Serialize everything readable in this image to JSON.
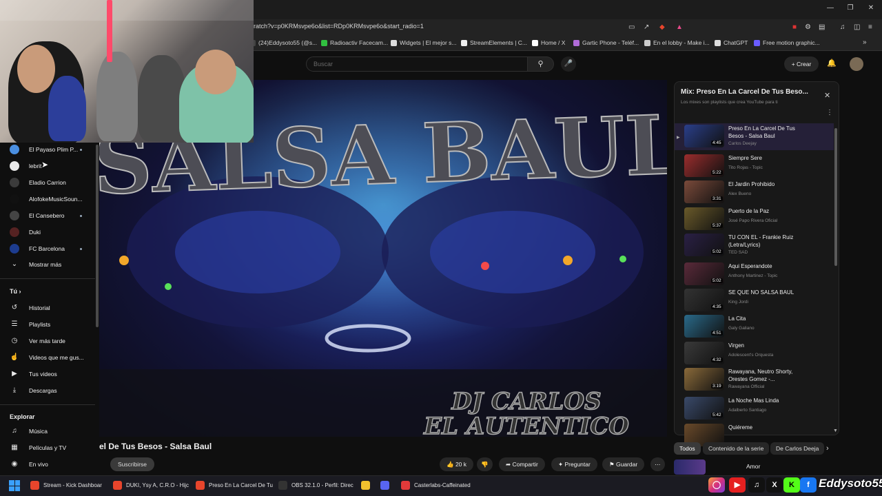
{
  "browser": {
    "url": "ratch?v=p0KRMsvpe6o&list=RDp0KRMsvpe6o&start_radio=1",
    "bookmarks": [
      {
        "label": "(24)Eddysoto55 (@s...",
        "color": "#444"
      },
      {
        "label": "Radioactiv Facecam...",
        "color": "#31c040"
      },
      {
        "label": "Widgets | El mejor s...",
        "color": "#ddd"
      },
      {
        "label": "StreamElements | C...",
        "color": "#eee"
      },
      {
        "label": "Home / X",
        "color": "#fff"
      },
      {
        "label": "Gartic Phone - Teléf...",
        "color": "#b06bd8"
      },
      {
        "label": "En el lobby - Make i...",
        "color": "#ccc"
      },
      {
        "label": "ChatGPT",
        "color": "#ddd"
      },
      {
        "label": "Free motion graphic...",
        "color": "#6a5cff"
      }
    ]
  },
  "header": {
    "search_placeholder": "Buscar",
    "create_label": "Crear"
  },
  "sidebar": {
    "subscriptions": [
      {
        "label": "El Payaso Plim P...",
        "color": "#4a8ee0",
        "dot": true
      },
      {
        "label": "lebrit",
        "color": "#e8e8e8",
        "dot": false
      },
      {
        "label": "Eladio Carrion",
        "color": "#3b3b3b",
        "dot": false
      },
      {
        "label": "AlofokeMusicSoun...",
        "color": "#111",
        "dot": false
      },
      {
        "label": "El Cansebero",
        "color": "#444",
        "dot": true
      },
      {
        "label": "Duki",
        "color": "#552222",
        "dot": false
      },
      {
        "label": "FC Barcelona",
        "color": "#1d3c8f",
        "dot": true
      }
    ],
    "show_more": "Mostrar más",
    "you_heading": "Tú",
    "you_items": [
      {
        "label": "Historial",
        "icon": "history-icon"
      },
      {
        "label": "Playlists",
        "icon": "playlists-icon"
      },
      {
        "label": "Ver más tarde",
        "icon": "watch-later-icon"
      },
      {
        "label": "Videos que me gus...",
        "icon": "liked-icon"
      },
      {
        "label": "Tus videos",
        "icon": "your-videos-icon"
      },
      {
        "label": "Descargas",
        "icon": "downloads-icon"
      }
    ],
    "explore_heading": "Explorar",
    "explore_items": [
      {
        "label": "Música",
        "icon": "music-icon"
      },
      {
        "label": "Películas y TV",
        "icon": "movies-icon"
      },
      {
        "label": "En vivo",
        "icon": "live-icon"
      }
    ]
  },
  "video": {
    "overlay_title": "SALSA BAUL",
    "overlay_credit_1": "DJ CARLOS",
    "overlay_credit_2": "EL AUTENTICO",
    "title": "el De Tus Besos - Salsa Baul",
    "subscribe_label": "Suscribirse",
    "likes": "20 k",
    "share_label": "Compartir",
    "ask_label": "Preguntar",
    "save_label": "Guardar"
  },
  "playlist": {
    "title": "Mix: Preso En La Carcel De Tus Beso...",
    "subtitle": "Los mixes son playlists que crea YouTube para ti",
    "items": [
      {
        "title": "Preso En La Carcel De Tus Besos - Salsa Baul",
        "channel": "Carlos Deejay",
        "duration": "4:45",
        "color": "#2a3f8a"
      },
      {
        "title": "Siempre Sere",
        "channel": "Tito Rojas - Topic",
        "duration": "5:22",
        "color": "#9a2d2d"
      },
      {
        "title": "El Jardin Prohibido",
        "channel": "Alex Bueno",
        "duration": "3:31",
        "color": "#7a4a3a"
      },
      {
        "title": "Puerto de la Paz",
        "channel": "José Papo Rivera Oficial",
        "duration": "5:37",
        "color": "#6a5a2a"
      },
      {
        "title": "TU CON EL - Frankie Ruiz (Letra/Lyrics)",
        "channel": "TED SAD",
        "duration": "5:02",
        "color": "#2a2045"
      },
      {
        "title": "Aqui Esperandote",
        "channel": "Anthony Martinez - Topic",
        "duration": "5:02",
        "color": "#5a2a3a"
      },
      {
        "title": "SE QUE NO SALSA BAUL",
        "channel": "King Jordi",
        "duration": "4:35",
        "color": "#333"
      },
      {
        "title": "La Cita",
        "channel": "Galy Galiano",
        "duration": "4:51",
        "color": "#2a6a8a"
      },
      {
        "title": "Virgen",
        "channel": "Adolescent's Orquesta",
        "duration": "4:32",
        "color": "#3a3a3a"
      },
      {
        "title": "Rawayana, Neutro Shorty, Orestes Gomez -...",
        "channel": "Rawayana Official",
        "duration": "3:19",
        "color": "#8a6a3a"
      },
      {
        "title": "La Noche Mas Linda",
        "channel": "Adalberto Santiago",
        "duration": "5:42",
        "color": "#3a4a6a"
      },
      {
        "title": "Quiéreme",
        "channel": "",
        "duration": "",
        "color": "#6a4a2a"
      }
    ]
  },
  "chips": [
    "Todos",
    "Contenido de la serie",
    "De Carlos Deeja"
  ],
  "next_item": "Amor",
  "taskbar": [
    {
      "label": "Stream - Kick Dashboar",
      "color": "#e8452c"
    },
    {
      "label": "DUKI, Ysy A, C.R.O - Hijc",
      "color": "#e8452c"
    },
    {
      "label": "Preso En La Carcel De Tu",
      "color": "#e8452c"
    },
    {
      "label": "OBS 32.1.0 - Perfil: Direc",
      "color": "#333"
    },
    {
      "label": "",
      "color": "#f2c12e"
    },
    {
      "label": "",
      "color": "#5865f2"
    },
    {
      "label": "Casterlabs-Caffeinated",
      "color": "#e23a3a"
    }
  ],
  "branding": "Eddysoto55"
}
